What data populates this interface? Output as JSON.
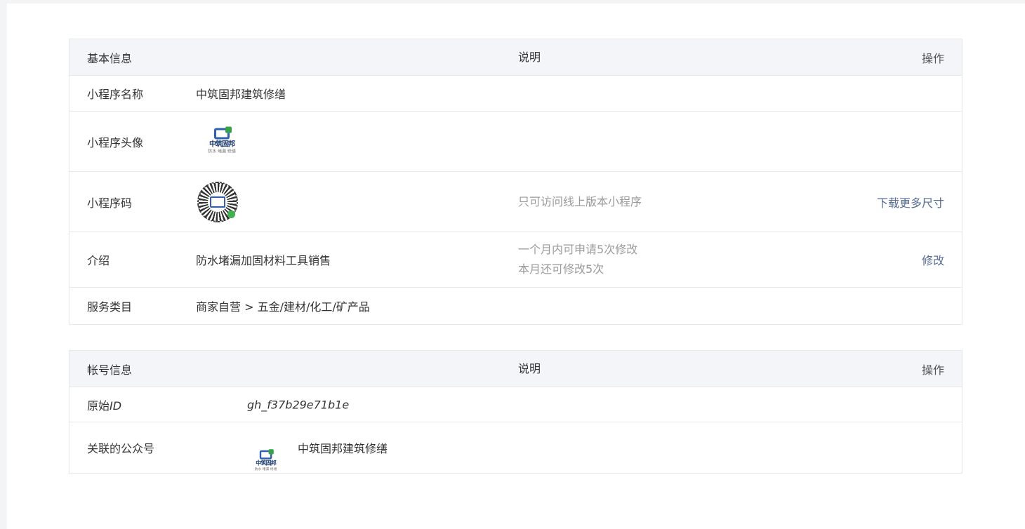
{
  "basic_table": {
    "header": {
      "col1": "基本信息",
      "col2": "说明",
      "col3": "操作"
    },
    "rows": {
      "name": {
        "label": "小程序名称",
        "value": "中筑固邦建筑修缮"
      },
      "avatar": {
        "label": "小程序头像",
        "logo_text": "中筑固邦",
        "logo_sub": "防水 堵漏 修缮"
      },
      "code": {
        "label": "小程序码",
        "desc": "只可访问线上版本小程序",
        "action": "下载更多尺寸"
      },
      "intro": {
        "label": "介绍",
        "value": "防水堵漏加固材料工具销售",
        "desc_line1": "一个月内可申请5次修改",
        "desc_line2": "本月还可修改5次",
        "action": "修改"
      },
      "category": {
        "label": "服务类目",
        "value": "商家自营 > 五金/建材/化工/矿产品"
      }
    }
  },
  "account_table": {
    "header": {
      "col1": "帐号信息",
      "col2": "说明",
      "col3": "操作"
    },
    "rows": {
      "original_id": {
        "label_prefix": "原始",
        "label_suffix": "ID",
        "value": "gh_f37b29e71b1e"
      },
      "linked_account": {
        "label": "关联的公众号",
        "logo_text": "中筑固邦",
        "logo_sub": "防水 堵漏 修缮",
        "value": "中筑固邦建筑修缮"
      }
    }
  },
  "icons": {
    "avatar": "brand-logo-icon",
    "qrcode": "mini-program-code-icon",
    "linked": "brand-logo-icon"
  },
  "colors": {
    "header_bg": "#f4f5f9",
    "border": "#e6e8eb",
    "muted_text": "#9a9a9a",
    "brand_blue": "#2d61b0",
    "brand_green": "#37a24a"
  }
}
